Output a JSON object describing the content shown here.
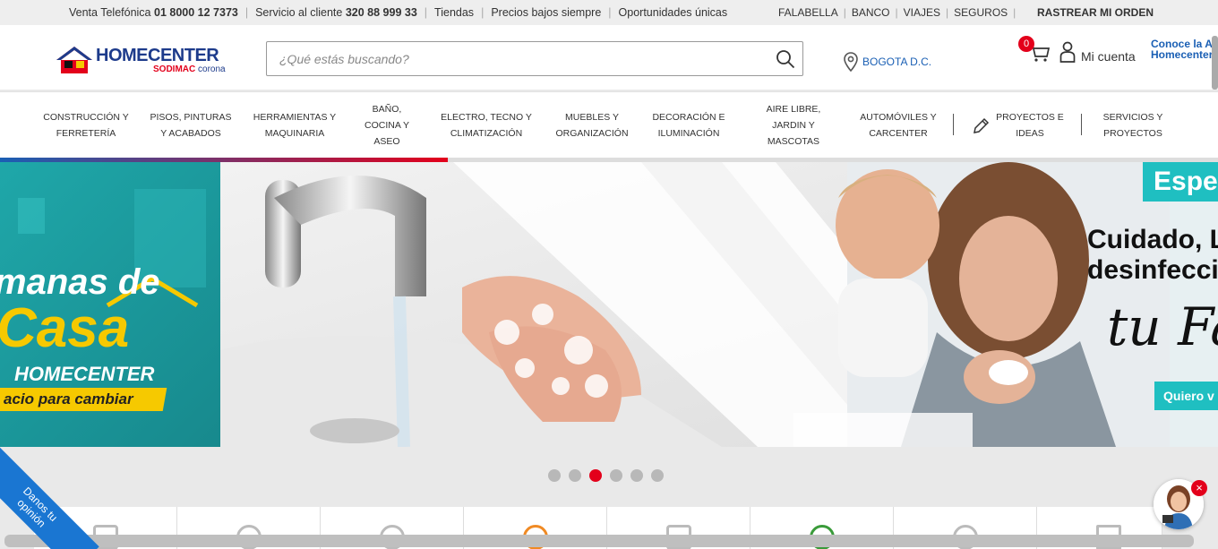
{
  "topbar": {
    "venta_label": "Venta Telefónica",
    "venta_phone": "01 8000 12 7373",
    "servicio_label": "Servicio al cliente",
    "servicio_phone": "320 88 999 33",
    "tiendas": "Tiendas",
    "precios": "Precios bajos siempre",
    "oportunidades": "Oportunidades únicas",
    "links": [
      "FALABELLA",
      "BANCO",
      "VIAJES",
      "SEGUROS"
    ],
    "track": "RASTREAR MI ORDEN"
  },
  "header": {
    "brand": "HOMECENTER",
    "sub_brand_a": "SODIMAC",
    "sub_brand_b": "corona",
    "search_placeholder": "¿Qué estás buscando?",
    "location": "BOGOTA D.C.",
    "cart_count": "0",
    "account": "Mi cuenta",
    "promo_line1": "Conoce la A",
    "promo_line2": "Homecenter"
  },
  "nav": [
    {
      "l1": "CONSTRUCCIÓN Y",
      "l2": "FERRETERÍA",
      "l3": ""
    },
    {
      "l1": "PISOS, PINTURAS",
      "l2": "Y ACABADOS",
      "l3": ""
    },
    {
      "l1": "HERRAMIENTAS Y",
      "l2": "MAQUINARIA",
      "l3": ""
    },
    {
      "l1": "BAÑO,",
      "l2": "COCINA Y",
      "l3": "ASEO"
    },
    {
      "l1": "ELECTRO, TECNO Y",
      "l2": "CLIMATIZACIÓN",
      "l3": ""
    },
    {
      "l1": "MUEBLES Y",
      "l2": "ORGANIZACIÓN",
      "l3": ""
    },
    {
      "l1": "DECORACIÓN E",
      "l2": "ILUMINACIÓN",
      "l3": ""
    },
    {
      "l1": "AIRE LIBRE,",
      "l2": "JARDIN Y",
      "l3": "MASCOTAS"
    },
    {
      "l1": "AUTOMÓVILES Y",
      "l2": "CARCENTER",
      "l3": ""
    },
    {
      "l1": "PROYECTOS E",
      "l2": "IDEAS",
      "l3": ""
    },
    {
      "l1": "SERVICIOS Y",
      "l2": "PROYECTOS",
      "l3": ""
    }
  ],
  "banner": {
    "left_line1": "manas de",
    "left_line2": "Casa",
    "left_line3": "HOMECENTER",
    "left_strip": "acio para cambiar",
    "right_tag": "Espe",
    "right_title1": "Cuidado, L",
    "right_title2": "desinfecci",
    "right_script": "tu Fa",
    "right_button": "Quiero v",
    "progress": 0.368
  },
  "dots": {
    "count": 6,
    "active": 2
  },
  "feedback": {
    "line1": "Danos tu",
    "line2": "opinión"
  },
  "colors": {
    "brand_blue": "#1d3b8b",
    "link_blue": "#1a5fb4",
    "red": "#e3001b",
    "teal": "#1fbfc1",
    "yellow": "#f6c900"
  }
}
